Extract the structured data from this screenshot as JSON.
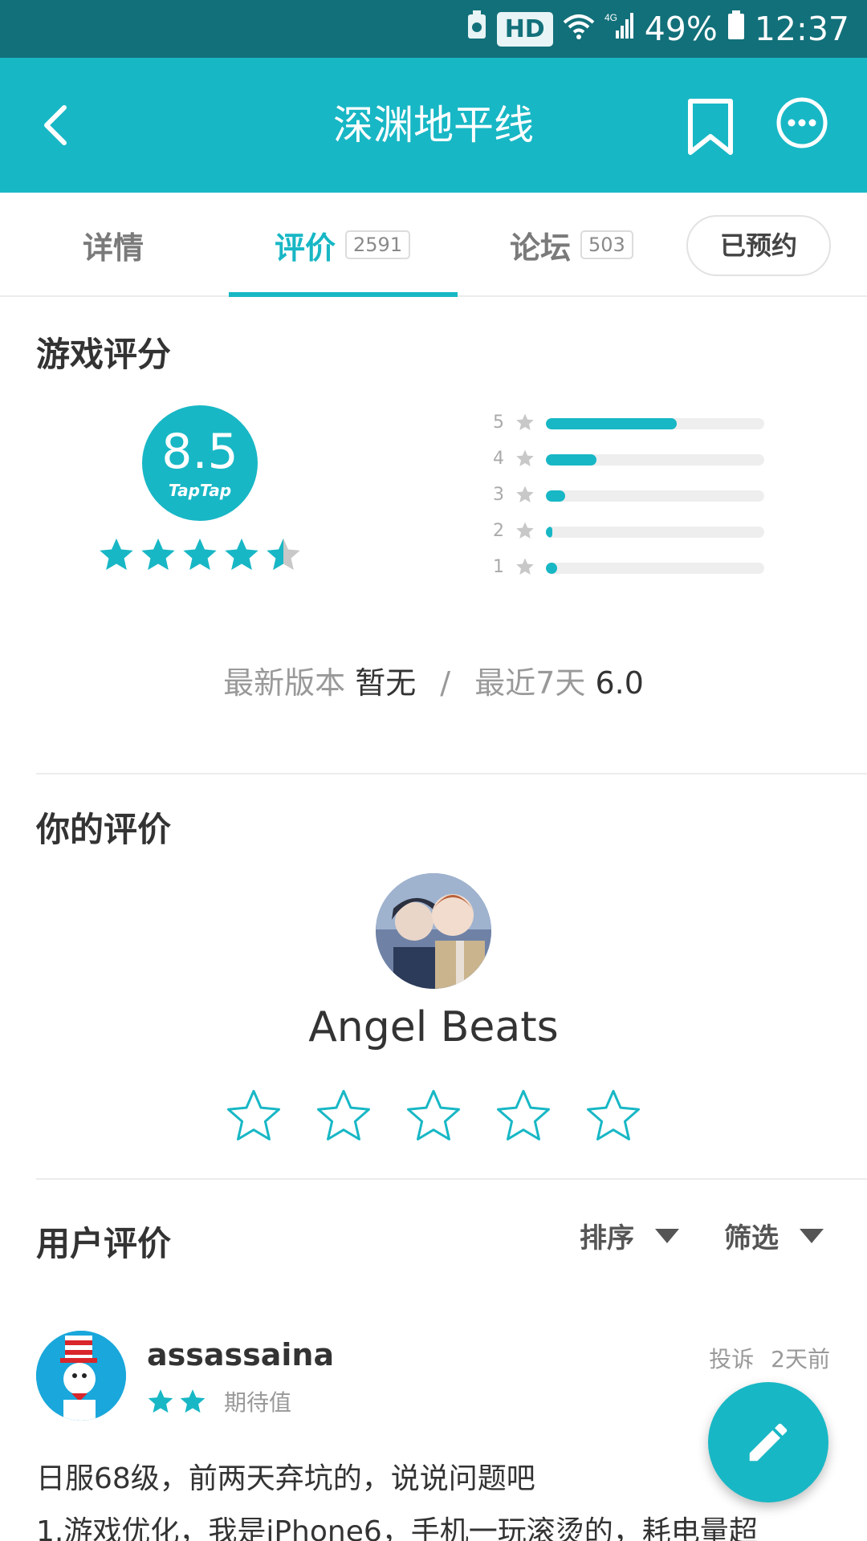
{
  "status_bar": {
    "hd": "HD",
    "network": "4G",
    "battery": "49%",
    "time": "12:37"
  },
  "app_bar": {
    "title": "深渊地平线"
  },
  "tabs": [
    {
      "label": "详情"
    },
    {
      "label": "评价",
      "count": "2591"
    },
    {
      "label": "论坛",
      "count": "503"
    }
  ],
  "reserve_button": "已预约",
  "game_rating": {
    "title": "游戏评分",
    "score": "8.5",
    "brand": "TapTap",
    "stars": 4.5,
    "distribution": [
      {
        "star": "5",
        "fraction": 0.6
      },
      {
        "star": "4",
        "fraction": 0.23
      },
      {
        "star": "3",
        "fraction": 0.09
      },
      {
        "star": "2",
        "fraction": 0.03
      },
      {
        "star": "1",
        "fraction": 0.05
      }
    ],
    "latest_version_label": "最新版本",
    "latest_version_value": "暂无",
    "separator": "/",
    "recent_label": "最近7天",
    "recent_value": "6.0"
  },
  "your_rating": {
    "title": "你的评价",
    "username": "Angel Beats",
    "star_count": 5
  },
  "user_reviews": {
    "title": "用户评价",
    "sort_label": "排序",
    "filter_label": "筛选",
    "review": {
      "author": "assassaina",
      "stars": 2,
      "tag": "期待值",
      "report": "投诉",
      "time": "2天前",
      "line1": "日服68级，前两天弃坑的，说说问题吧",
      "line2": "1.游戏优化，我是iPhone6，手机一玩滚烫的，耗电量超"
    }
  },
  "colors": {
    "accent": "#18b7c5",
    "status_bar": "#12707a"
  }
}
